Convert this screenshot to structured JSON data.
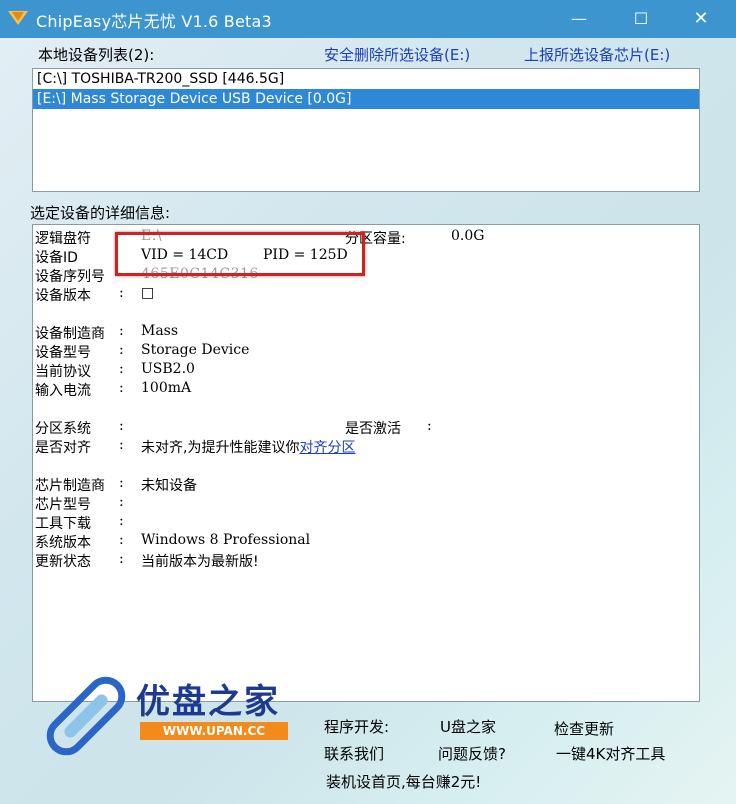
{
  "window": {
    "title": "ChipEasy芯片无忧 V1.6 Beta3",
    "controls": {
      "minimize": "—",
      "maximize": "☐",
      "close": "✕"
    }
  },
  "device_list": {
    "label": "本地设备列表(2):",
    "safe_remove_link": "安全删除所选设备(E:)",
    "report_chip_link": "上报所选设备芯片(E:)",
    "items": [
      {
        "text": "[C:\\] TOSHIBA-TR200_SSD [446.5G]",
        "selected": false
      },
      {
        "text": "[E:\\] Mass Storage Device USB Device [0.0G]",
        "selected": true
      }
    ]
  },
  "details": {
    "label": "选定设备的详细信息:",
    "logical_drive": {
      "label": "逻辑盘符",
      "value": "E:\\"
    },
    "partition_capacity": {
      "label": "分区容量:",
      "value": "0.0G"
    },
    "device_id": {
      "label": "设备ID",
      "vid": "VID = 14CD",
      "pid": "PID = 125D"
    },
    "serial": {
      "label": "设备序列号",
      "value": "465E0C14C316"
    },
    "version": {
      "label": "设备版本",
      "value": "□"
    },
    "manufacturer": {
      "label": "设备制造商",
      "value": "Mass"
    },
    "model": {
      "label": "设备型号",
      "value": "Storage Device"
    },
    "protocol": {
      "label": "当前协议",
      "value": "USB2.0"
    },
    "current": {
      "label": "输入电流",
      "value": "100mA"
    },
    "partition_system": {
      "label": "分区系统",
      "value": ""
    },
    "activated": {
      "label": "是否激活",
      "value": ""
    },
    "aligned": {
      "label": "是否对齐",
      "value": "未对齐,为提升性能建议你",
      "link": "对齐分区"
    },
    "chip_manufacturer": {
      "label": "芯片制造商",
      "value": "未知设备"
    },
    "chip_model": {
      "label": "芯片型号",
      "value": ""
    },
    "tool_download": {
      "label": "工具下载",
      "value": ""
    },
    "os_version": {
      "label": "系统版本",
      "value": "Windows 8 Professional"
    },
    "update_status": {
      "label": "更新状态",
      "value": "当前版本为最新版!"
    },
    "colon": ":"
  },
  "footer": {
    "logo_text": "优盘之家",
    "logo_url": "WWW.UPAN.CC",
    "developer_label": "程序开发:",
    "developer_value": "U盘之家",
    "contact": "联系我们",
    "feedback": "问题反馈?",
    "check_update": "检查更新",
    "align_tool": "一键4K对齐工具",
    "promo": "装机设首页,每台赚2元!"
  },
  "colors": {
    "titlebar": "#3d95d0",
    "link": "#1a3fc0",
    "selection": "#2e88d8",
    "highlight_box": "#d42020",
    "logo_orange": "#f48a1a",
    "logo_blue": "#1d3a8e"
  }
}
